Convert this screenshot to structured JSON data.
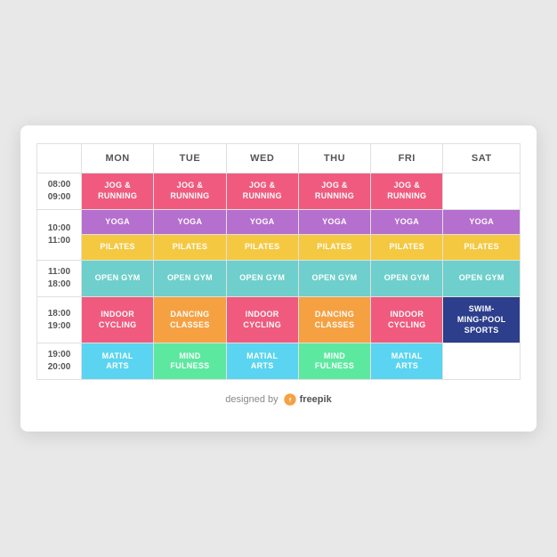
{
  "table": {
    "headers": [
      "",
      "MON",
      "TUE",
      "WED",
      "THU",
      "FRI",
      "SAT"
    ],
    "rows": [
      {
        "time": [
          "08:00",
          "09:00"
        ],
        "cells": [
          {
            "label": "JOG &\nRUNNING",
            "color": "#f05a7e",
            "empty": false
          },
          {
            "label": "JOG &\nRUNNING",
            "color": "#f05a7e",
            "empty": false
          },
          {
            "label": "JOG &\nRUNNING",
            "color": "#f05a7e",
            "empty": false
          },
          {
            "label": "JOG &\nRUNNING",
            "color": "#f05a7e",
            "empty": false
          },
          {
            "label": "JOG &\nRUNNING",
            "color": "#f05a7e",
            "empty": false
          },
          {
            "label": "",
            "color": "",
            "empty": true
          }
        ]
      },
      {
        "time": [
          "10:00",
          "11:00"
        ],
        "cells": [
          {
            "label": "YOGA",
            "color": "#b56fcf",
            "empty": false
          },
          {
            "label": "YOGA",
            "color": "#b56fcf",
            "empty": false
          },
          {
            "label": "YOGA",
            "color": "#b56fcf",
            "empty": false
          },
          {
            "label": "YOGA",
            "color": "#b56fcf",
            "empty": false
          },
          {
            "label": "YOGA",
            "color": "#b56fcf",
            "empty": false
          },
          {
            "label": "YOGA",
            "color": "#b56fcf",
            "empty": false
          },
          {
            "label": "PILATES",
            "color": "#f5c842",
            "empty": false
          },
          {
            "label": "PILATES",
            "color": "#f5c842",
            "empty": false
          },
          {
            "label": "PILATES",
            "color": "#f5c842",
            "empty": false
          },
          {
            "label": "PILATES",
            "color": "#f5c842",
            "empty": false
          },
          {
            "label": "PILATES",
            "color": "#f5c842",
            "empty": false
          },
          {
            "label": "PILATES",
            "color": "#f5c842",
            "empty": false
          }
        ]
      },
      {
        "time": [
          "11:00",
          "18:00"
        ],
        "cells": [
          {
            "label": "OPEN GYM",
            "color": "#6ecfcc",
            "empty": false
          },
          {
            "label": "OPEN GYM",
            "color": "#6ecfcc",
            "empty": false
          },
          {
            "label": "OPEN GYM",
            "color": "#6ecfcc",
            "empty": false
          },
          {
            "label": "OPEN GYM",
            "color": "#6ecfcc",
            "empty": false
          },
          {
            "label": "OPEN GYM",
            "color": "#6ecfcc",
            "empty": false
          },
          {
            "label": "OPEN GYM",
            "color": "#6ecfcc",
            "empty": false
          }
        ]
      },
      {
        "time": [
          "18:00",
          "19:00"
        ],
        "cells": [
          {
            "label": "INDOOR\nCYCLING",
            "color": "#f05a7e",
            "empty": false
          },
          {
            "label": "DANCING\nCLASSES",
            "color": "#f5a142",
            "empty": false
          },
          {
            "label": "INDOOR\nCYCLING",
            "color": "#f05a7e",
            "empty": false
          },
          {
            "label": "DANCING\nCLASSES",
            "color": "#f5a142",
            "empty": false
          },
          {
            "label": "INDOOR\nCYCLING",
            "color": "#f05a7e",
            "empty": false
          },
          {
            "label": "SWIM-\nMING-POOL\nSPORTS",
            "color": "#2c3e8c",
            "empty": false
          }
        ]
      },
      {
        "time": [
          "19:00",
          "20:00"
        ],
        "cells": [
          {
            "label": "MATIAL\nARTS",
            "color": "#5ad4f0",
            "empty": false
          },
          {
            "label": "MIND\nFULNESS",
            "color": "#5de8a0",
            "empty": false
          },
          {
            "label": "MATIAL\nARTS",
            "color": "#5ad4f0",
            "empty": false
          },
          {
            "label": "MIND\nFULNESS",
            "color": "#5de8a0",
            "empty": false
          },
          {
            "label": "MATIAL\nARTS",
            "color": "#5ad4f0",
            "empty": false
          },
          {
            "label": "",
            "color": "",
            "empty": true
          }
        ]
      }
    ]
  },
  "footer": {
    "text": "designed by",
    "brand": "freepik"
  }
}
